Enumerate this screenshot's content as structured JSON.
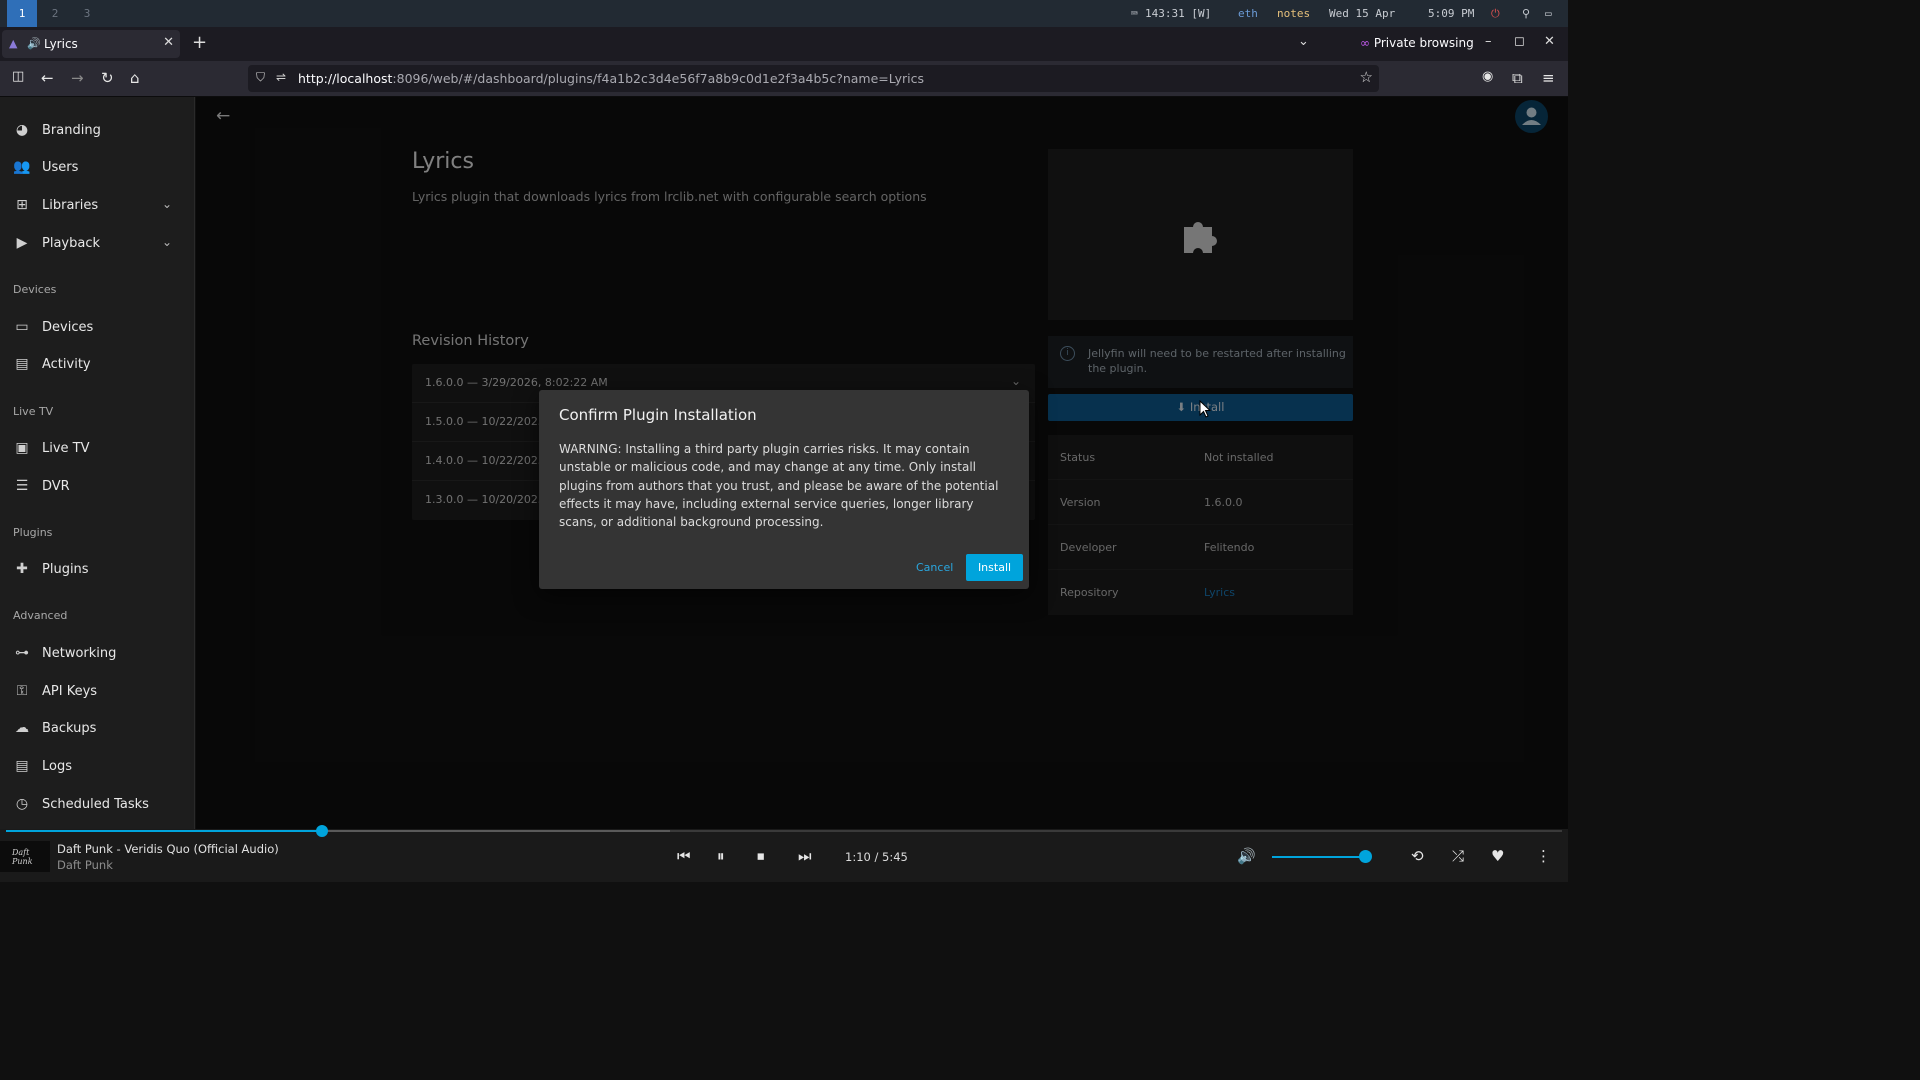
{
  "system_bar": {
    "workspaces": [
      "1",
      "2",
      "3"
    ],
    "active_workspace": "1",
    "keyboard": "143:31 [W]",
    "network": "eth",
    "notes": "notes",
    "date": "Wed 15 Apr",
    "time": "5:09 PM",
    "colors": {
      "notes": "#e6c07b",
      "power": "#e05252"
    }
  },
  "browser": {
    "tab_title": "Lyrics",
    "private_label": "Private browsing",
    "url_host": "http://localhost",
    "url_rest": ":8096/web/#/dashboard/plugins/f4a1b2c3d4e56f7a8b9c0d1e2f3a4b5c?name=Lyrics"
  },
  "sidebar": {
    "items_top": [
      {
        "label": "Branding",
        "icon": "palette-icon"
      },
      {
        "label": "Users",
        "icon": "users-icon"
      },
      {
        "label": "Libraries",
        "icon": "library-add-icon",
        "expandable": true
      },
      {
        "label": "Playback",
        "icon": "play-circle-icon",
        "expandable": true
      }
    ],
    "headers": {
      "devices": "Devices",
      "live_tv": "Live TV",
      "plugins": "Plugins",
      "advanced": "Advanced"
    },
    "devices_items": [
      {
        "label": "Devices",
        "icon": "devices-icon"
      },
      {
        "label": "Activity",
        "icon": "activity-chart-icon"
      }
    ],
    "live_tv_items": [
      {
        "label": "Live TV",
        "icon": "live-tv-icon"
      },
      {
        "label": "DVR",
        "icon": "dvr-icon"
      }
    ],
    "plugins_items": [
      {
        "label": "Plugins",
        "icon": "puzzle-icon"
      }
    ],
    "advanced_items": [
      {
        "label": "Networking",
        "icon": "network-icon"
      },
      {
        "label": "API Keys",
        "icon": "key-icon"
      },
      {
        "label": "Backups",
        "icon": "cloud-upload-icon"
      },
      {
        "label": "Logs",
        "icon": "logs-icon"
      },
      {
        "label": "Scheduled Tasks",
        "icon": "clock-icon"
      }
    ]
  },
  "plugin": {
    "title": "Lyrics",
    "description": "Lyrics plugin that downloads lyrics from lrclib.net with configurable search options",
    "revision_title": "Revision History",
    "revisions": [
      "1.6.0.0 — 3/29/2026, 8:02:22 AM",
      "1.5.0.0 — 10/22/2025,",
      "1.4.0.0 — 10/22/2025,",
      "1.3.0.0 — 10/20/2025,"
    ],
    "restart_notice": "Jellyfin will need to be restarted after installing the plugin.",
    "install_label": "Install",
    "details": [
      {
        "key": "Status",
        "value": "Not installed"
      },
      {
        "key": "Version",
        "value": "1.6.0.0"
      },
      {
        "key": "Developer",
        "value": "Felitendo"
      },
      {
        "key": "Repository",
        "value": "Lyrics"
      }
    ]
  },
  "dialog": {
    "title": "Confirm Plugin Installation",
    "body": "WARNING: Installing a third party plugin carries risks. It may contain unstable or malicious code, and may change at any time. Only install plugins from authors that you trust, and please be aware of the potential effects it may have, including external service queries, longer library scans, or additional background processing.",
    "cancel_label": "Cancel",
    "install_label": "Install"
  },
  "player": {
    "track": "Daft Punk - Veridis Quo (Official Audio)",
    "artist": "Daft Punk",
    "time": "1:10 / 5:45",
    "progress_fraction": 0.203,
    "buffered_fraction": 0.427,
    "volume_fraction": 0.97,
    "accent": "#00a4dc"
  }
}
